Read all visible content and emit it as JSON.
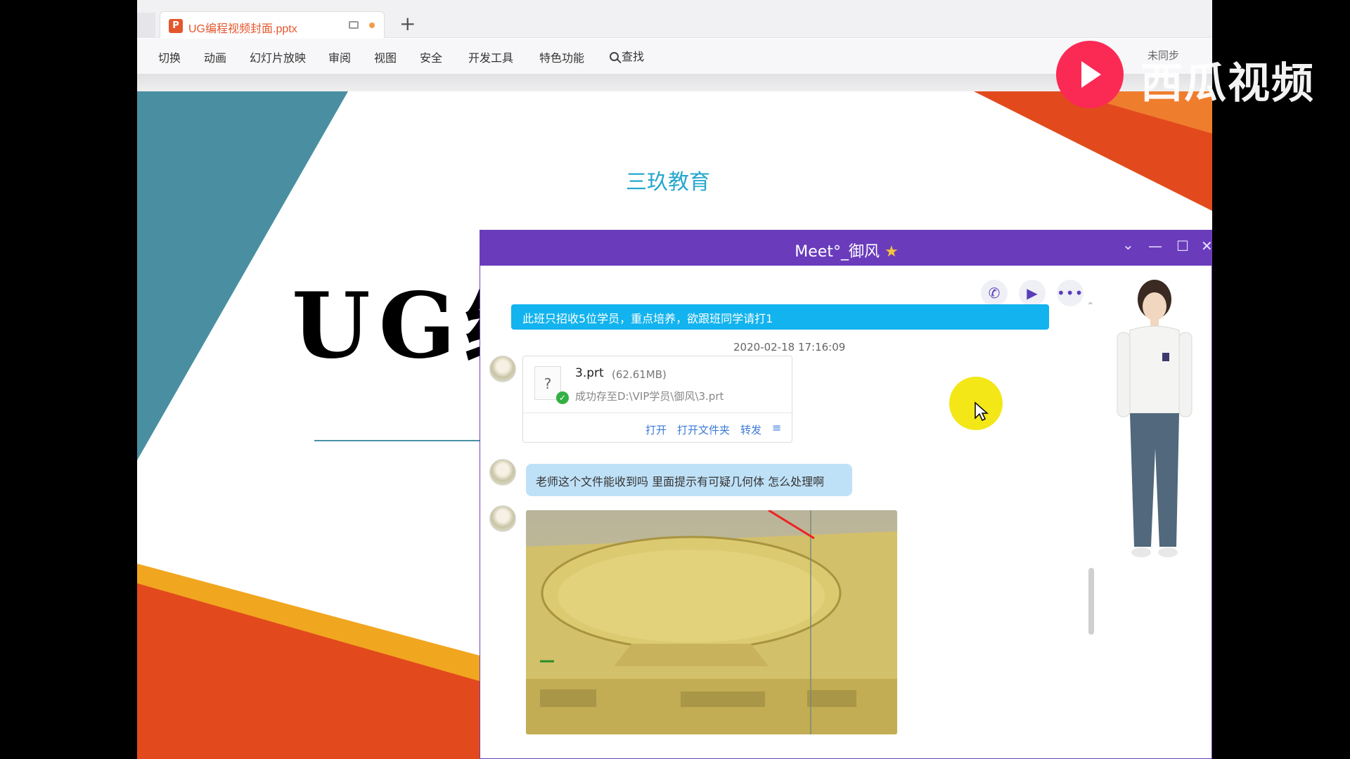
{
  "wps": {
    "doc_tab_title": "UG编程视频封面.pptx",
    "new_tab_label": "+",
    "menu": [
      "切换",
      "动画",
      "幻灯片放映",
      "审阅",
      "视图",
      "安全",
      "开发工具",
      "特色功能"
    ],
    "search_label": "查找",
    "sync_label": "未同步"
  },
  "slide": {
    "brand": "三玖教育",
    "title": "UG编"
  },
  "chat": {
    "title": "Meet°_御风",
    "title_icon": "star",
    "notice": "此班只招收5位学员，重点培养，欲跟班同学请打1",
    "timestamp": "2020-02-18 17:16:09",
    "file": {
      "name": "3.prt",
      "size": "(62.61MB)",
      "status": "成功存至D:\\VIP学员\\御风\\3.prt",
      "actions": [
        "打开",
        "打开文件夹",
        "转发"
      ]
    },
    "message": "老师这个文件能收到吗 里面提示有可疑几何体 怎么处理啊",
    "colors": {
      "titlebar": "#6a3cbc",
      "notice": "#12b3ee",
      "bubble": "#bfe1f7"
    }
  },
  "watermark": {
    "text": "西瓜视频",
    "color": "#fb2a54"
  }
}
